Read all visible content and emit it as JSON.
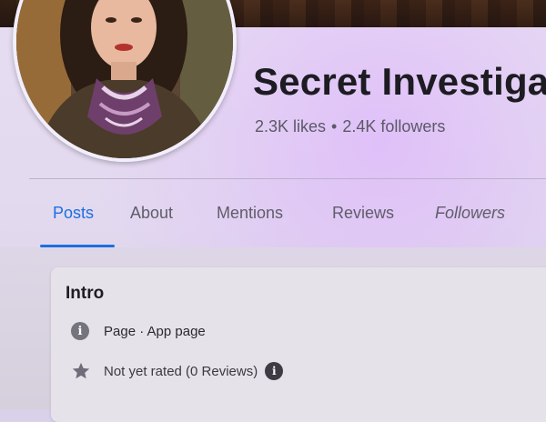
{
  "page": {
    "name": "Secret Investiga",
    "likes": "2.3K likes",
    "separator": "•",
    "followers": "2.4K followers"
  },
  "tabs": [
    {
      "label": "Posts",
      "active": true
    },
    {
      "label": "About",
      "active": false
    },
    {
      "label": "Mentions",
      "active": false
    },
    {
      "label": "Reviews",
      "active": false
    },
    {
      "label": "Followers",
      "active": false
    }
  ],
  "intro": {
    "title": "Intro",
    "category_icon": "info-icon",
    "category": "Page · App page",
    "rating_icon": "star-icon",
    "rating": "Not yet rated (0 Reviews)",
    "rating_info_icon": "info-icon"
  },
  "colors": {
    "accent": "#1c6fe0",
    "text_primary": "#1d1c22",
    "text_secondary": "#5b5968"
  }
}
